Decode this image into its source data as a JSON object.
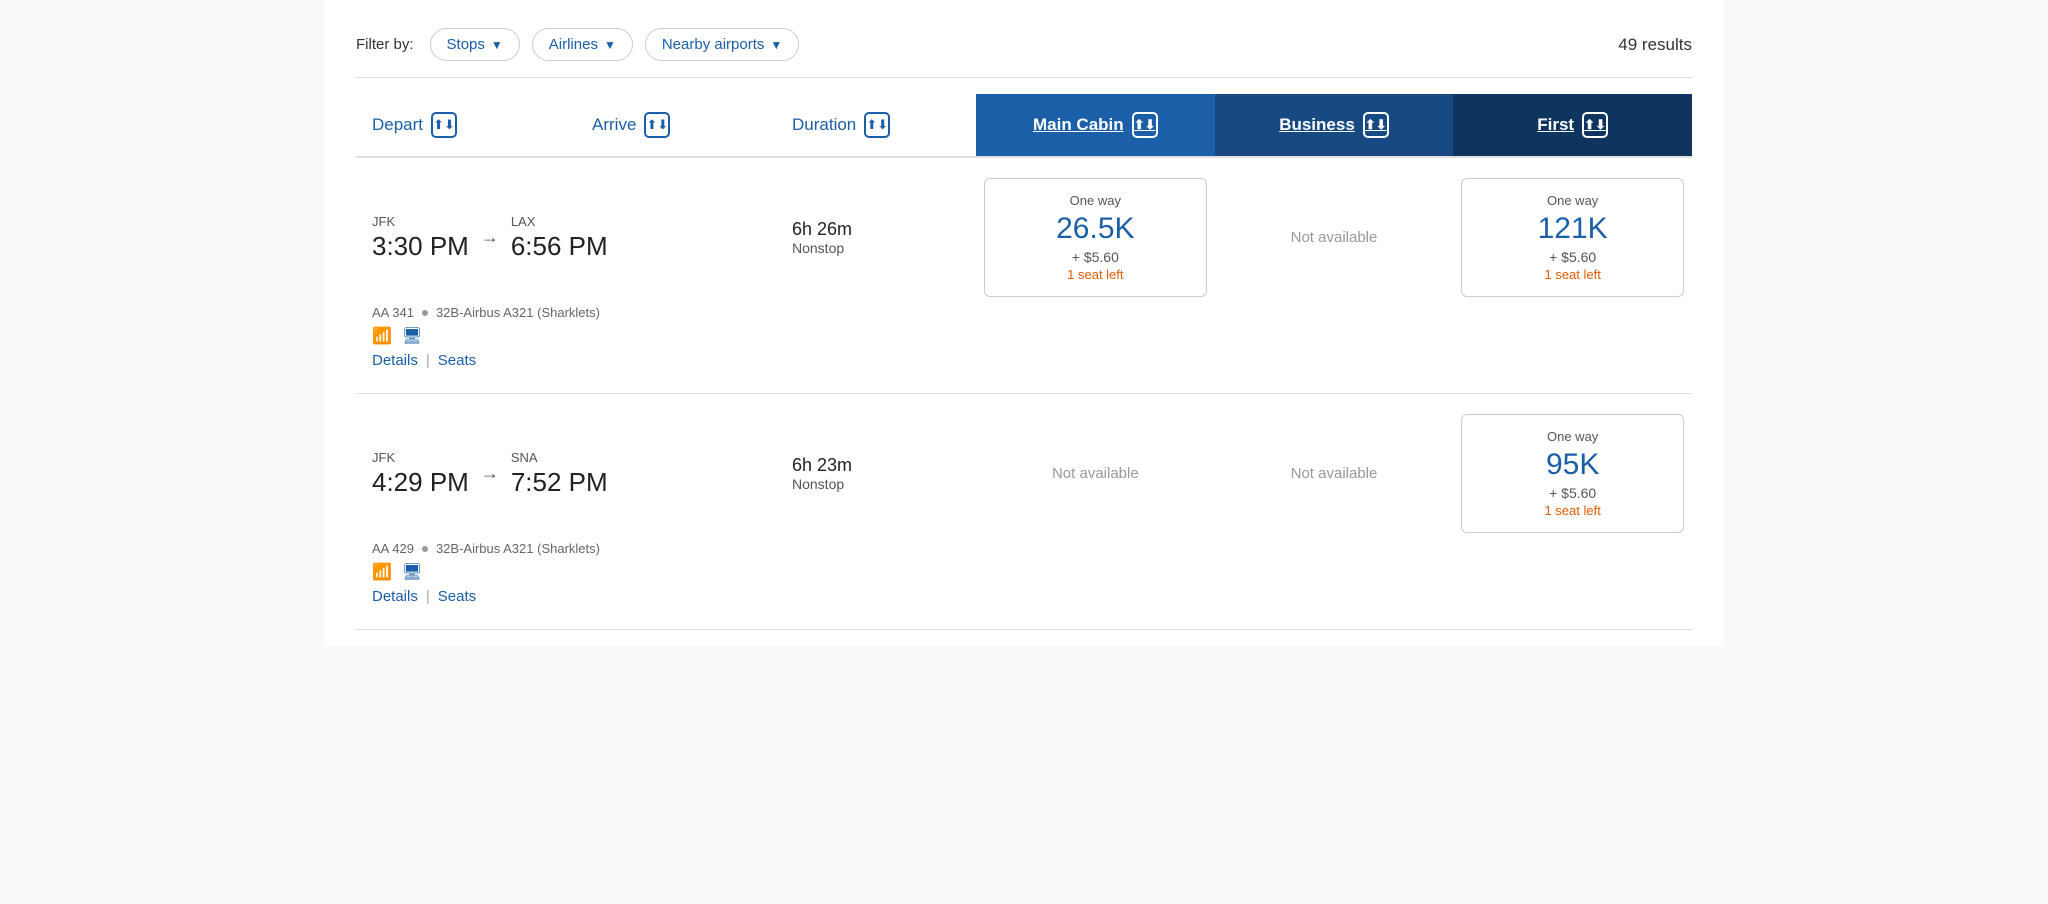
{
  "filter_bar": {
    "label": "Filter by:",
    "buttons": [
      {
        "id": "stops",
        "label": "Stops"
      },
      {
        "id": "airlines",
        "label": "Airlines"
      },
      {
        "id": "nearby_airports",
        "label": "Nearby airports"
      }
    ],
    "results_count": "49 results"
  },
  "columns": {
    "depart": "Depart",
    "arrive": "Arrive",
    "duration": "Duration",
    "main_cabin": "Main Cabin",
    "business": "Business",
    "first": "First"
  },
  "flights": [
    {
      "id": "flight-1",
      "depart_code": "JFK",
      "depart_time": "3:30 PM",
      "arrive_code": "LAX",
      "arrive_time": "6:56 PM",
      "duration": "6h 26m",
      "stops": "Nonstop",
      "flight_number": "AA 341",
      "aircraft": "32B-Airbus A321 (Sharklets)",
      "main_cabin": {
        "available": true,
        "one_way_label": "One way",
        "miles": "26.5K",
        "cash": "+ $5.60",
        "seats": "1 seat left"
      },
      "business": {
        "available": false,
        "label": "Not available"
      },
      "first": {
        "available": true,
        "one_way_label": "One way",
        "miles": "121K",
        "cash": "+ $5.60",
        "seats": "1 seat left"
      },
      "details_label": "Details",
      "seats_label": "Seats"
    },
    {
      "id": "flight-2",
      "depart_code": "JFK",
      "depart_time": "4:29 PM",
      "arrive_code": "SNA",
      "arrive_time": "7:52 PM",
      "duration": "6h 23m",
      "stops": "Nonstop",
      "flight_number": "AA 429",
      "aircraft": "32B-Airbus A321 (Sharklets)",
      "main_cabin": {
        "available": false,
        "label": "Not available"
      },
      "business": {
        "available": false,
        "label": "Not available"
      },
      "first": {
        "available": true,
        "one_way_label": "One way",
        "miles": "95K",
        "cash": "+ $5.60",
        "seats": "1 seat left"
      },
      "details_label": "Details",
      "seats_label": "Seats"
    }
  ]
}
